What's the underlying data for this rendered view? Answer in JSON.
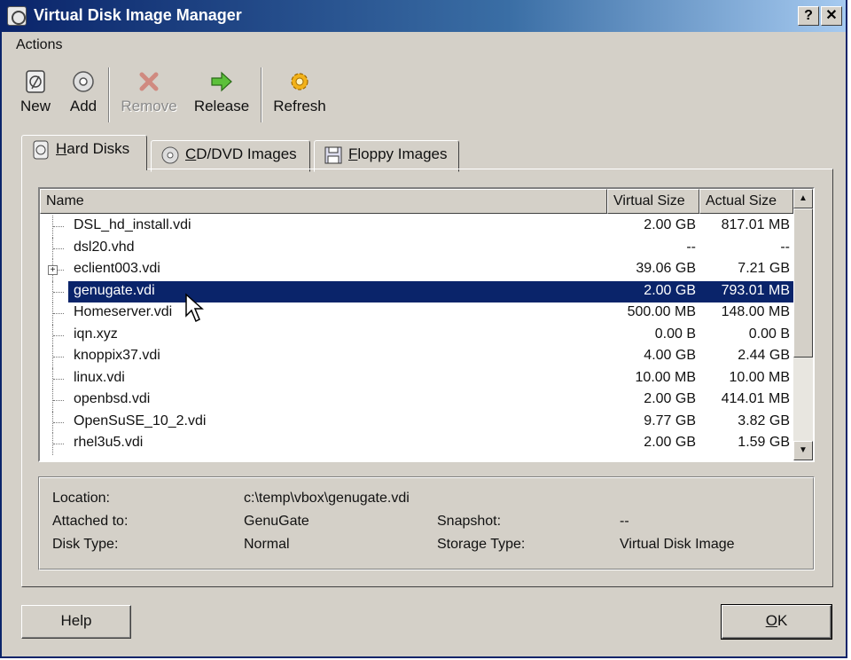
{
  "window": {
    "title": "Virtual Disk Image Manager",
    "help_btn": "?",
    "close_btn": "✕"
  },
  "menu": {
    "actions": "Actions"
  },
  "toolbar": {
    "new": "New",
    "add": "Add",
    "remove": "Remove",
    "release": "Release",
    "refresh": "Refresh"
  },
  "tabs": [
    {
      "label": "Hard Disks",
      "underline": "H",
      "rest": "ard Disks",
      "icon": "hard-disk-icon"
    },
    {
      "label": "CD/DVD Images",
      "underline": "C",
      "rest": "D/DVD Images",
      "icon": "cd-dvd-icon"
    },
    {
      "label": "Floppy Images",
      "underline": "F",
      "rest": "loppy Images",
      "icon": "floppy-icon"
    }
  ],
  "list": {
    "columns": [
      "Name",
      "Virtual Size",
      "Actual Size"
    ],
    "rows": [
      {
        "name": "DSL_hd_install.vdi",
        "virtual": "2.00 GB",
        "actual": "817.01 MB"
      },
      {
        "name": "dsl20.vhd",
        "virtual": "--",
        "actual": "--"
      },
      {
        "name": "eclient003.vdi",
        "virtual": "39.06 GB",
        "actual": "7.21 GB",
        "expandable": true
      },
      {
        "name": "genugate.vdi",
        "virtual": "2.00 GB",
        "actual": "793.01 MB",
        "selected": true
      },
      {
        "name": "Homeserver.vdi",
        "virtual": "500.00 MB",
        "actual": "148.00 MB"
      },
      {
        "name": "iqn.xyz",
        "virtual": "0.00 B",
        "actual": "0.00 B"
      },
      {
        "name": "knoppix37.vdi",
        "virtual": "4.00 GB",
        "actual": "2.44 GB"
      },
      {
        "name": "linux.vdi",
        "virtual": "10.00 MB",
        "actual": "10.00 MB"
      },
      {
        "name": "openbsd.vdi",
        "virtual": "2.00 GB",
        "actual": "414.01 MB"
      },
      {
        "name": "OpenSuSE_10_2.vdi",
        "virtual": "9.77 GB",
        "actual": "3.82 GB"
      },
      {
        "name": "rhel3u5.vdi",
        "virtual": "2.00 GB",
        "actual": "1.59 GB"
      }
    ]
  },
  "details": {
    "location_label": "Location:",
    "location_value": "c:\\temp\\vbox\\genugate.vdi",
    "attached_label": "Attached to:",
    "attached_value": "GenuGate",
    "snapshot_label": "Snapshot:",
    "snapshot_value": "--",
    "disktype_label": "Disk Type:",
    "disktype_value": "Normal",
    "storage_label": "Storage Type:",
    "storage_value": "Virtual Disk Image"
  },
  "buttons": {
    "help": "Help",
    "ok_underline": "O",
    "ok_rest": "K"
  },
  "colors": {
    "titlebar": "#0a246a",
    "selection": "#0a246a",
    "face": "#d4d0c8"
  }
}
